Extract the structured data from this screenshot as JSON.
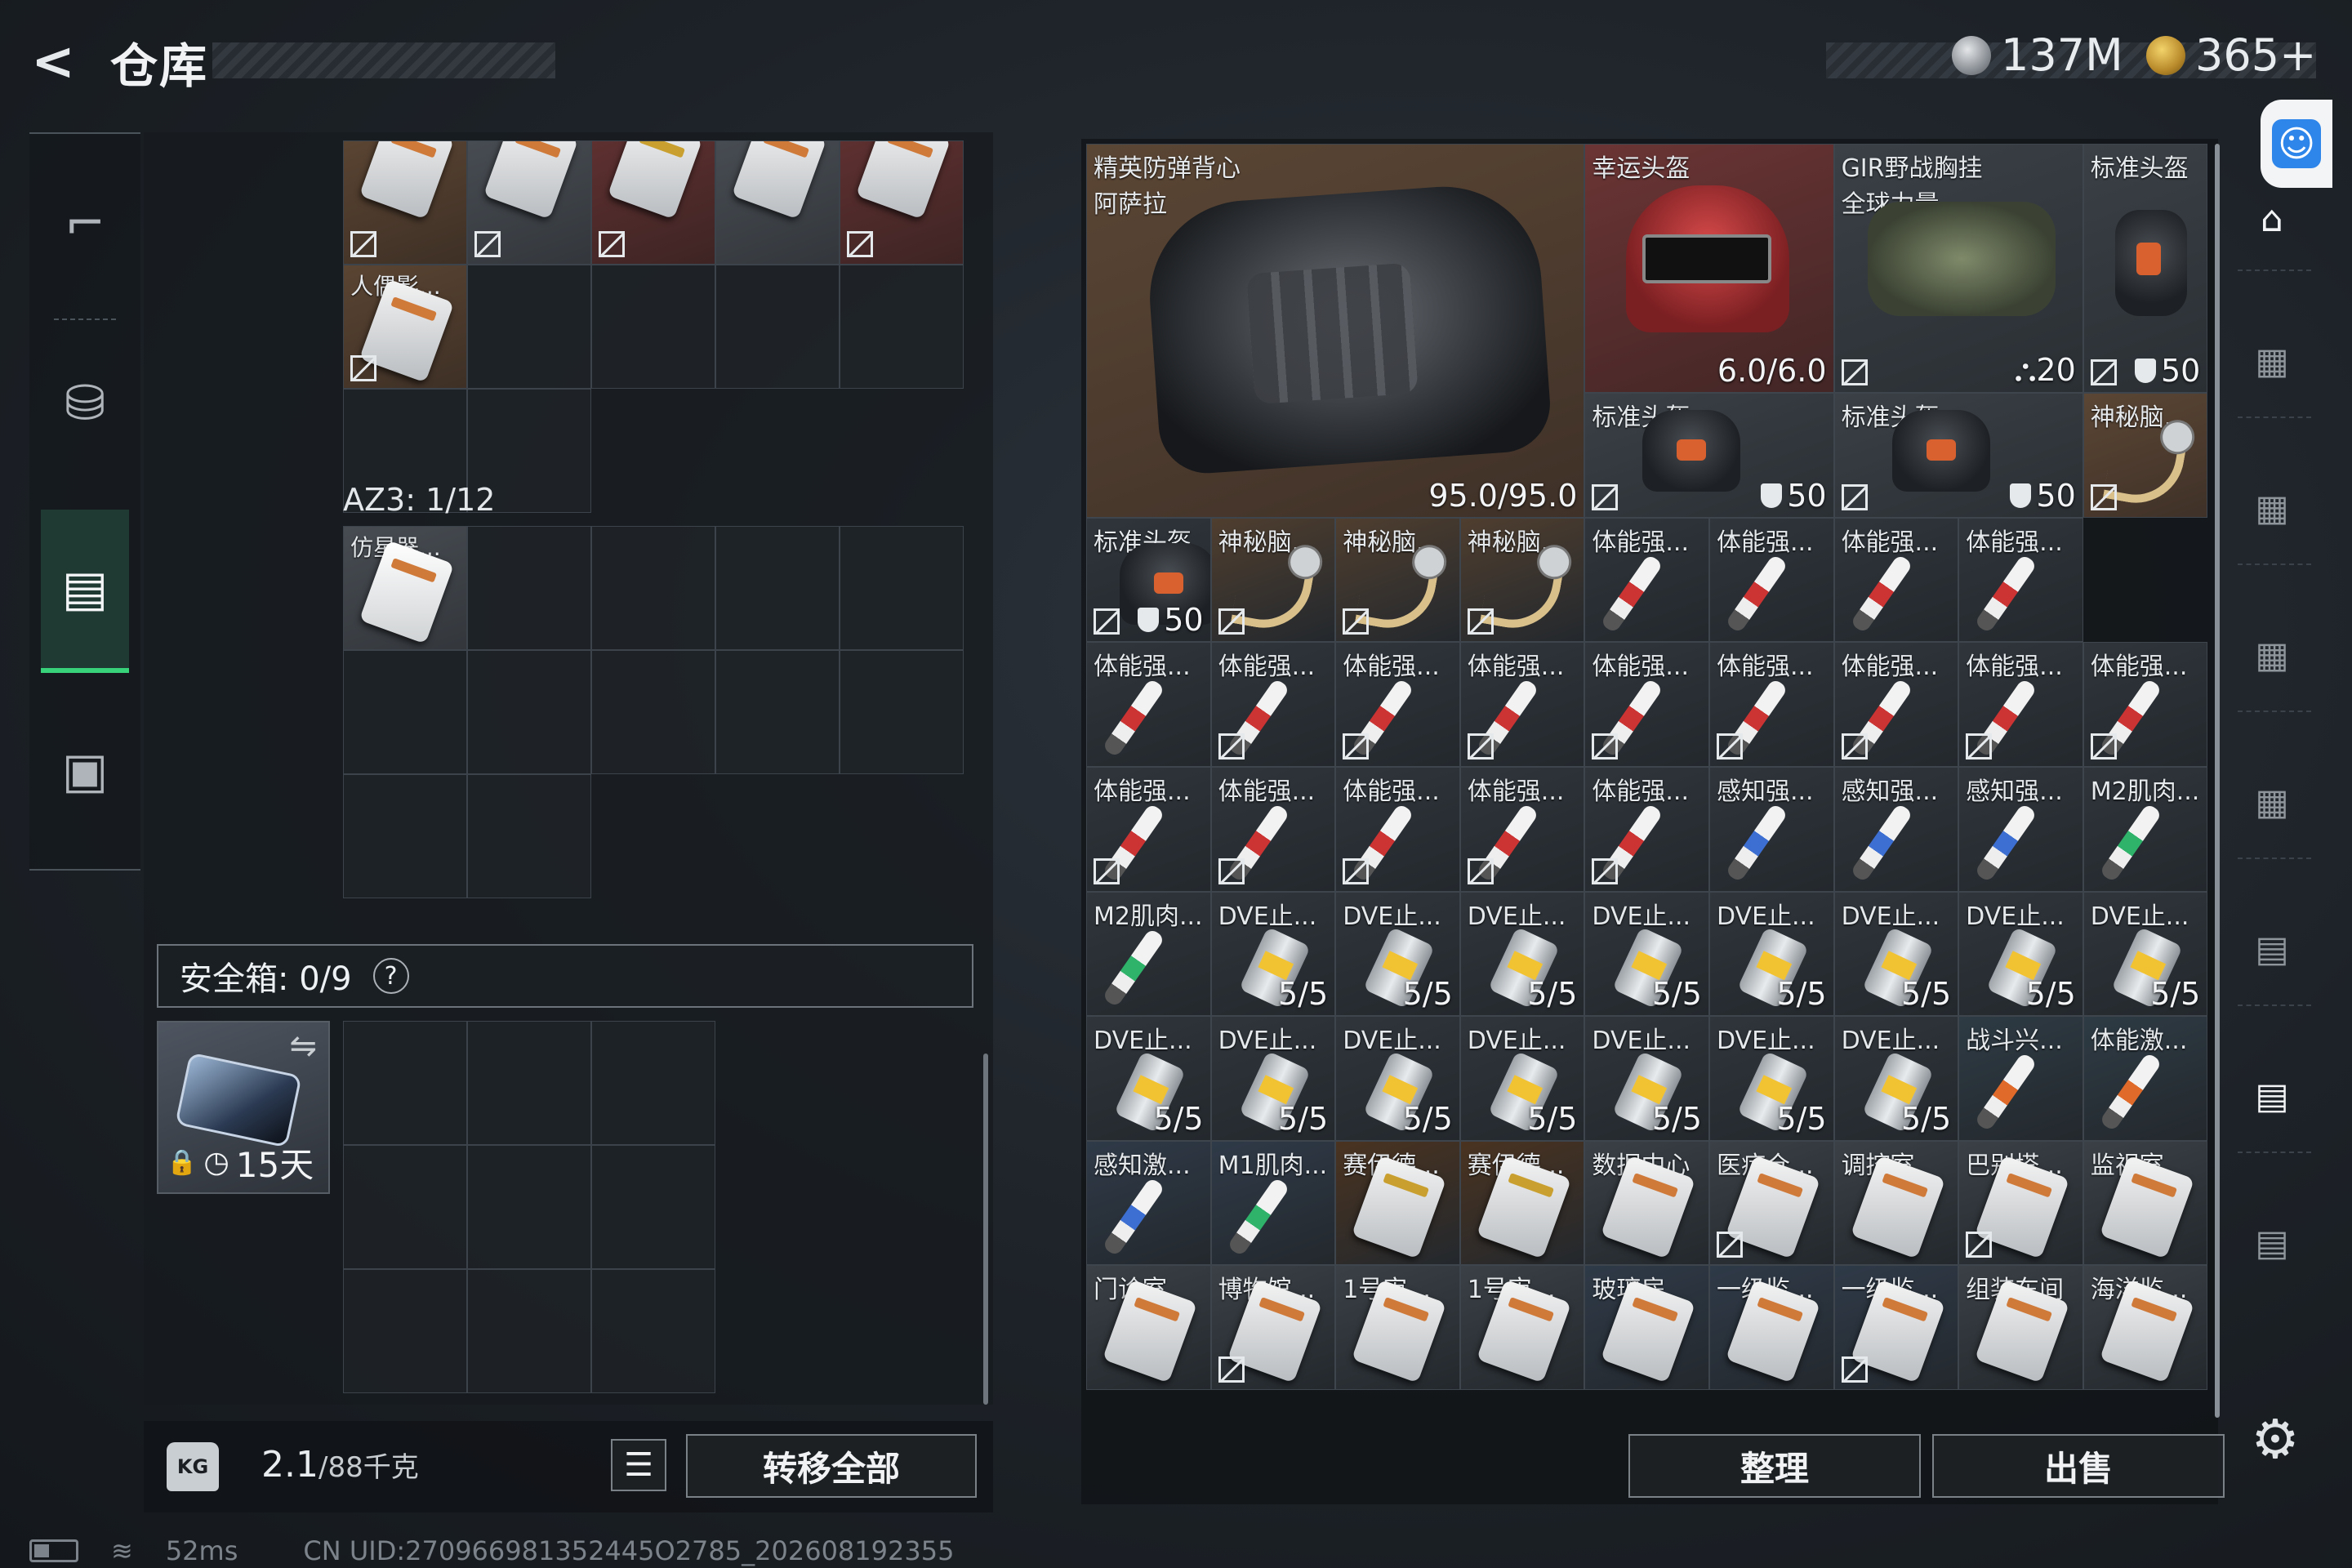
{
  "header": {
    "title": "仓库",
    "currency1": "137M",
    "currency2": "365+"
  },
  "left_nav": {
    "icons": [
      "gun-icon",
      "backpack-icon",
      "clipboard-icon",
      "briefcase-icon"
    ]
  },
  "stash_top": {
    "row1": [
      "",
      "",
      "",
      "",
      ""
    ],
    "item_label": "人偶影..."
  },
  "az3": {
    "label": "AZ3: 1/12",
    "item_label": "仿星器..."
  },
  "safe": {
    "label": "安全箱: 0/9",
    "help": "?",
    "days": "15天"
  },
  "footer": {
    "weight": "2.1",
    "weight_max": "/88千克",
    "transfer_all": "转移全部",
    "kg_icon": "KG"
  },
  "status": {
    "ping": "52ms",
    "uid": "CN UID:270966981352445O2785_202608192355"
  },
  "inventory": {
    "vest": {
      "name": "精英防弹背心\n阿萨拉",
      "durability": "95.0/95.0"
    },
    "lucky_helmet": {
      "name": "幸运头盔",
      "durability": "6.0/6.0"
    },
    "rig": {
      "name": "GIR野战胸挂\n全球力量",
      "value": "20"
    },
    "std_helmet_top": {
      "name": "标准头盔",
      "value": "50"
    },
    "std_helmet_a": {
      "name": "标准头盔",
      "value": "50"
    },
    "std_helmet_b": {
      "name": "标准头盔",
      "value": "50"
    },
    "mystery_top": {
      "name": "神秘脑..."
    },
    "row3": [
      {
        "name": "标准头盔",
        "value": "50"
      },
      {
        "name": "神秘脑..."
      },
      {
        "name": "神秘脑..."
      },
      {
        "name": "神秘脑..."
      },
      {
        "name": "体能强..."
      },
      {
        "name": "体能强..."
      },
      {
        "name": "体能强..."
      },
      {
        "name": "体能强..."
      }
    ],
    "row4": [
      "体能强...",
      "体能强...",
      "体能强...",
      "体能强...",
      "体能强...",
      "体能强...",
      "体能强...",
      "体能强...",
      "体能强..."
    ],
    "row5": [
      "体能强...",
      "体能强...",
      "体能强...",
      "体能强...",
      "体能强...",
      "感知强...",
      "感知强...",
      "感知强...",
      "M2肌肉..."
    ],
    "row6": [
      "M2肌肉...",
      "DVE止...",
      "DVE止...",
      "DVE止...",
      "DVE止...",
      "DVE止...",
      "DVE止...",
      "DVE止...",
      "DVE止..."
    ],
    "row7": [
      "DVE止...",
      "DVE止...",
      "DVE止...",
      "DVE止...",
      "DVE止...",
      "DVE止...",
      "DVE止...",
      "战斗兴...",
      "体能激..."
    ],
    "row8": [
      "感知激...",
      "M1肌肉...",
      "赛伊德...",
      "赛伊德...",
      "数据中心",
      "医疗仓...",
      "调控室",
      "巴别塔...",
      "监视室"
    ],
    "row9": [
      "门诊室",
      "博物馆...",
      "1号审...",
      "1号审...",
      "玻璃房",
      "一级监...",
      "一级监...",
      "组装车间",
      "海洋监..."
    ],
    "stack": "5/5",
    "sort_button": "整理",
    "sell_button": "出售"
  }
}
